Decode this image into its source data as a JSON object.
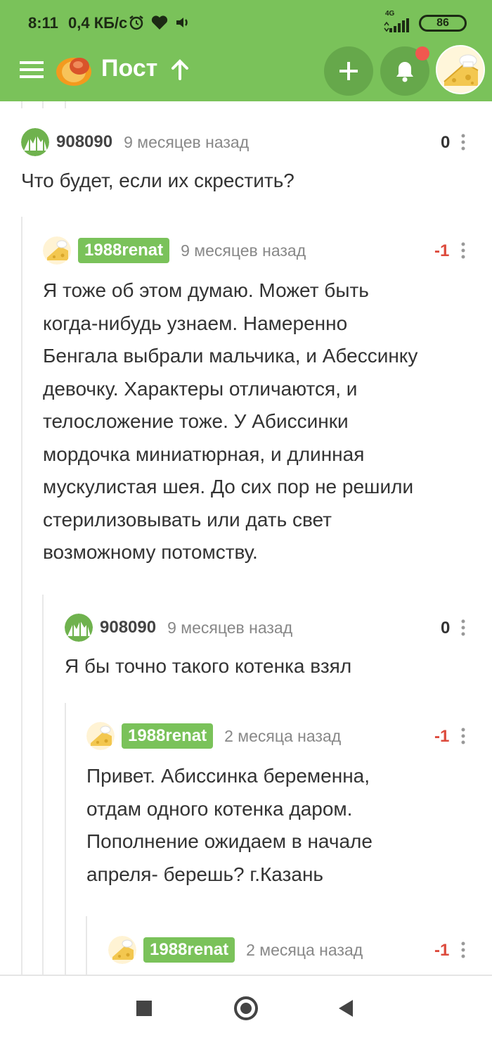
{
  "status_bar": {
    "time": "8:11",
    "speed": "0,4 КБ/с",
    "network": "4G",
    "battery": "86"
  },
  "app_bar": {
    "title": "Пост"
  },
  "colors": {
    "brand_green": "#7ac25a",
    "negative_rating": "#dd4b3d"
  },
  "comments": [
    {
      "author": "908090",
      "time": "9 месяцев назад",
      "rating": "0",
      "text": "Что будет, если их скрестить?",
      "avatar_icon": "green-mountains-icon"
    },
    {
      "author": "1988renat",
      "time": "9 месяцев назад",
      "rating": "-1",
      "text_lines": [
        "Я тоже об этом думаю. Может быть",
        "когда-нибудь узнаем. Намеренно",
        "Бенгала выбрали мальчика, и Абессинку",
        "девочку. Характеры отличаются, и",
        "телосложение тоже. У Абиссинки",
        "мордочка миниатюрная, и длинная",
        "мускулистая шея. До сих пор не решили",
        "стерилизовывать или дать свет",
        "возможному потомству."
      ],
      "avatar_icon": "cheese-chef-icon"
    },
    {
      "author": "908090",
      "time": "9 месяцев назад",
      "rating": "0",
      "text": "Я бы точно такого котенка взял",
      "avatar_icon": "green-mountains-icon"
    },
    {
      "author": "1988renat",
      "time": "2 месяца назад",
      "rating": "-1",
      "text_lines": [
        "Привет. Абиссинка беременна,",
        "отдам одного котенка даром.",
        "Пополнение ожидаем в начале",
        "апреля- берешь? г.Казань"
      ],
      "avatar_icon": "cheese-chef-icon"
    },
    {
      "author": "1988renat",
      "time": "2 месяца назад",
      "rating": "-1",
      "avatar_icon": "cheese-chef-icon"
    }
  ]
}
